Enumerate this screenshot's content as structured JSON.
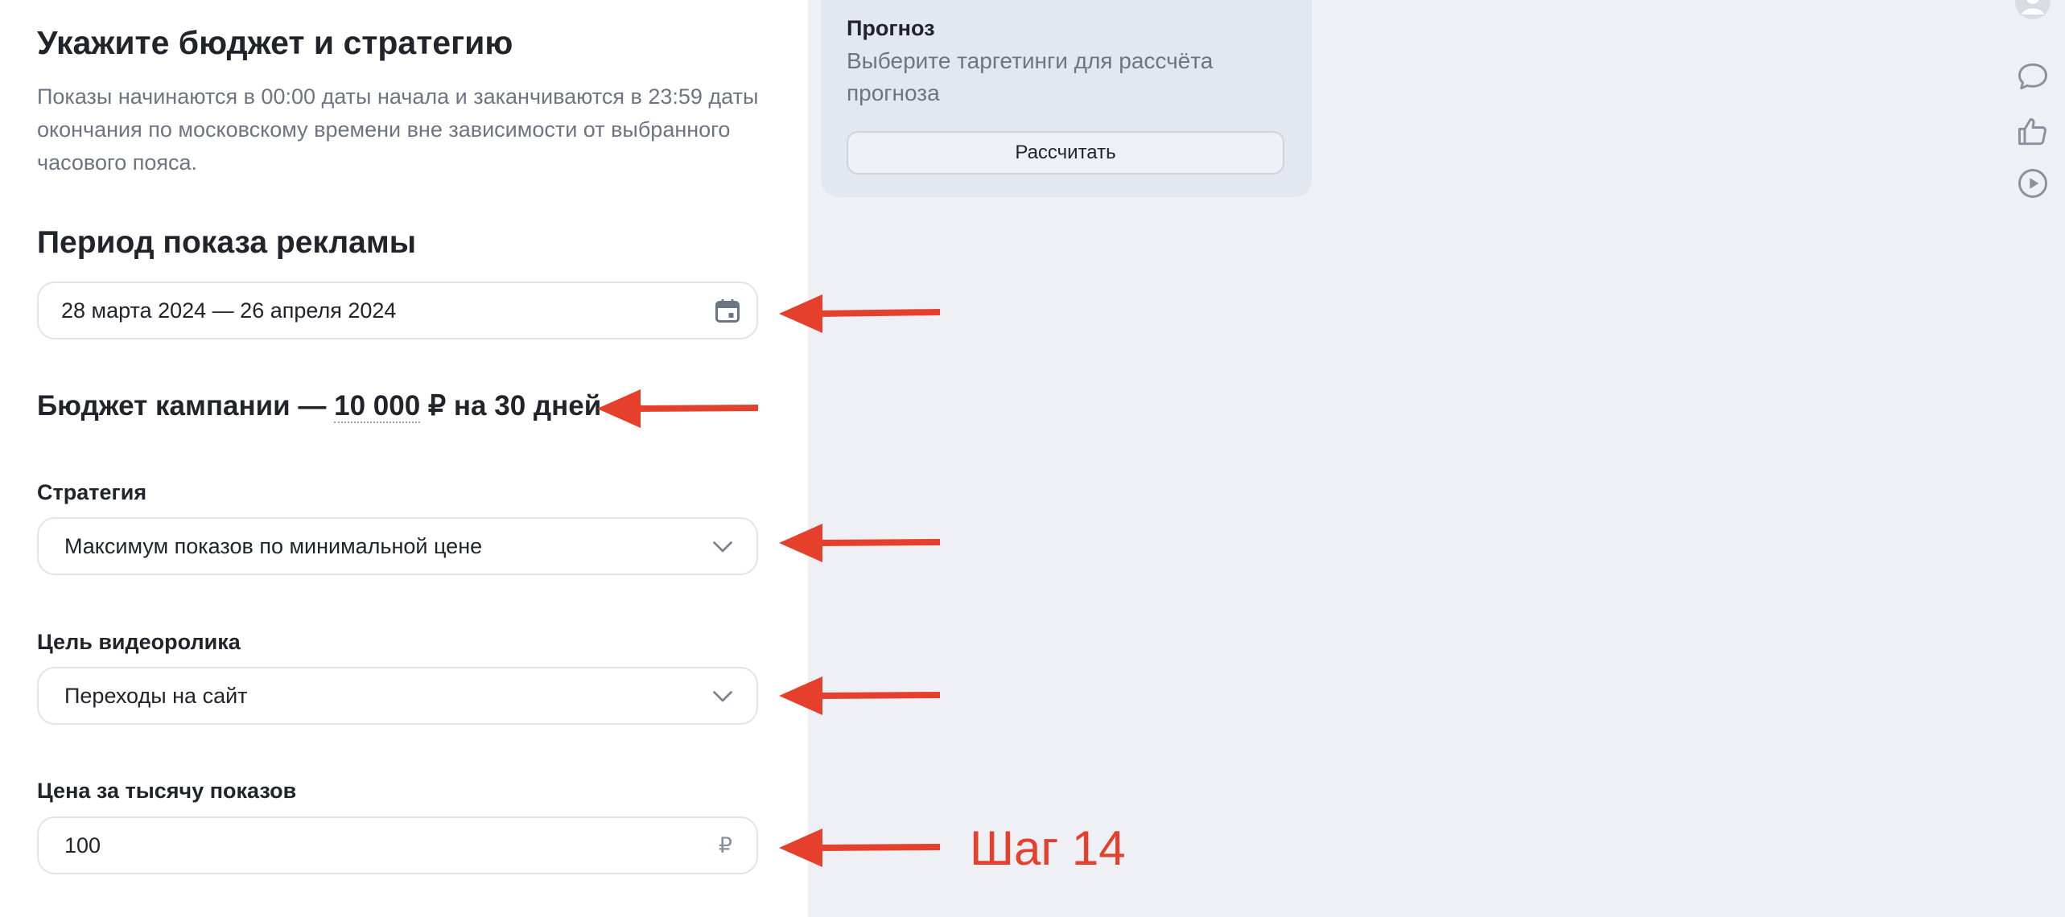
{
  "main": {
    "title": "Укажите бюджет и стратегию",
    "description": "Показы начинаются в 00:00 даты начала и заканчиваются в 23:59 даты окончания по московскому времени вне зависимости от выбранного часового пояса.",
    "period": {
      "heading": "Период показа рекламы",
      "value": "28 марта 2024 — 26 апреля 2024",
      "icon": "calendar-icon"
    },
    "budget": {
      "prefix": "Бюджет кампании — ",
      "amount": "10 000",
      "suffix": " ₽ на 30 дней"
    },
    "strategy": {
      "label": "Стратегия",
      "value": "Максимум показов по минимальной цене",
      "icon": "chevron-down-icon"
    },
    "video_goal": {
      "label": "Цель видеоролика",
      "value": "Переходы на сайт",
      "icon": "chevron-down-icon"
    },
    "cpm": {
      "label": "Цена за тысячу показов",
      "value": "100",
      "currency": "₽"
    }
  },
  "forecast": {
    "title": "Прогноз",
    "text": "Выберите таргетинги для рассчёта прогноза",
    "button_label": "Рассчитать"
  },
  "side_icons": [
    "avatar",
    "chat-icon",
    "thumbs-up-icon",
    "play-icon"
  ],
  "annotation": {
    "step_label": "Шаг 14",
    "color": "#e4402b"
  },
  "colors": {
    "page_bg": "#eef0f5",
    "panel_bg": "#ffffff",
    "card_bg": "#e3e7ef",
    "text": "#21242b",
    "muted_text": "#6d7482",
    "border": "#e1e4ea"
  }
}
